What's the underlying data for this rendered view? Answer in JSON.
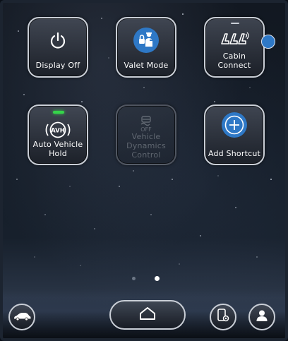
{
  "shortcuts": [
    {
      "label": "Display Off",
      "icon": "power-icon",
      "enabled": true
    },
    {
      "label": "Valet Mode",
      "icon": "valet-icon",
      "enabled": true
    },
    {
      "label": "Cabin Connect",
      "icon": "cabin-connect-icon",
      "enabled": true
    },
    {
      "label": "Auto Vehicle Hold",
      "icon": "avh-icon",
      "enabled": true,
      "indicator_on": true
    },
    {
      "label": "Vehicle Dynamics Control",
      "icon": "vdc-off-icon",
      "enabled": false,
      "icon_text": "OFF"
    },
    {
      "label": "Add Shortcut",
      "icon": "plus-icon",
      "enabled": true
    }
  ],
  "avh_icon_text": "AVH",
  "pager": {
    "pages": 2,
    "current": 2
  },
  "dock": {
    "left": {
      "icon": "car-icon"
    },
    "center": {
      "icon": "home-icon"
    },
    "right1": {
      "icon": "phone-settings-icon"
    },
    "right2": {
      "icon": "profile-icon"
    }
  },
  "colors": {
    "accent_blue": "#2e78c6",
    "indicator_green": "#35d44a",
    "tile_border": "#c9ced6"
  }
}
